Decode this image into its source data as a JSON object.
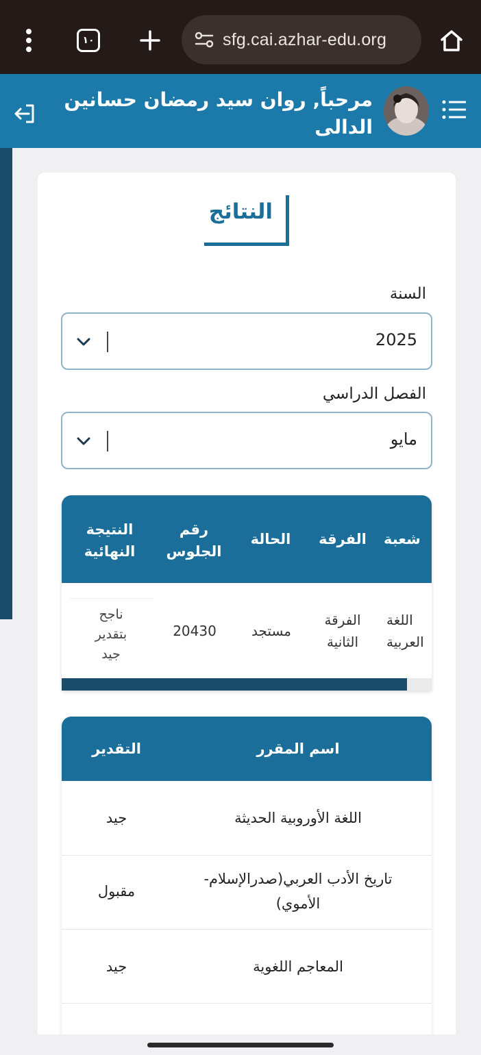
{
  "browser": {
    "url": "sfg.cai.azhar-edu.org",
    "tab_count": "١٠"
  },
  "header": {
    "welcome": "مرحباً, روان سيد رمضان حسانين الدالى"
  },
  "page": {
    "title": "النتائج",
    "year_label": "السنة",
    "year_value": "2025",
    "term_label": "الفصل الدراسي",
    "term_value": "مايو"
  },
  "results_table": {
    "headers": {
      "division": "شعبة",
      "level": "الفرقة",
      "status": "الحالة",
      "seat_line1": "رقم",
      "seat_line2": "الجلوس",
      "final_line1": "النتيجة",
      "final_line2": "النهائية"
    },
    "row": {
      "division_line1": "اللغة",
      "division_line2": "العربية",
      "level_line1": "الفرقة",
      "level_line2": "الثانية",
      "status": "مستجد",
      "seat": "20430",
      "final_line1": "ناجح",
      "final_line2": "بتقدير",
      "final_line3": "جيد"
    }
  },
  "courses_table": {
    "headers": {
      "course": "اسم المقرر",
      "grade": "التقدير"
    },
    "rows": [
      {
        "course_line1": "اللغة الأوروبية الحديثة",
        "course_line2": "",
        "grade": "جيد"
      },
      {
        "course_line1": "تاريخ الأدب العربي(صدرالإسلام-",
        "course_line2": "الأموي)",
        "grade": "مقبول"
      },
      {
        "course_line1": "المعاجم اللغوية",
        "course_line2": "",
        "grade": "جيد"
      }
    ]
  },
  "colors": {
    "primary": "#1c7aab",
    "table_header": "#1c6e9a",
    "dark_strip": "#1a4d6b",
    "browser_bg": "#241a18"
  }
}
